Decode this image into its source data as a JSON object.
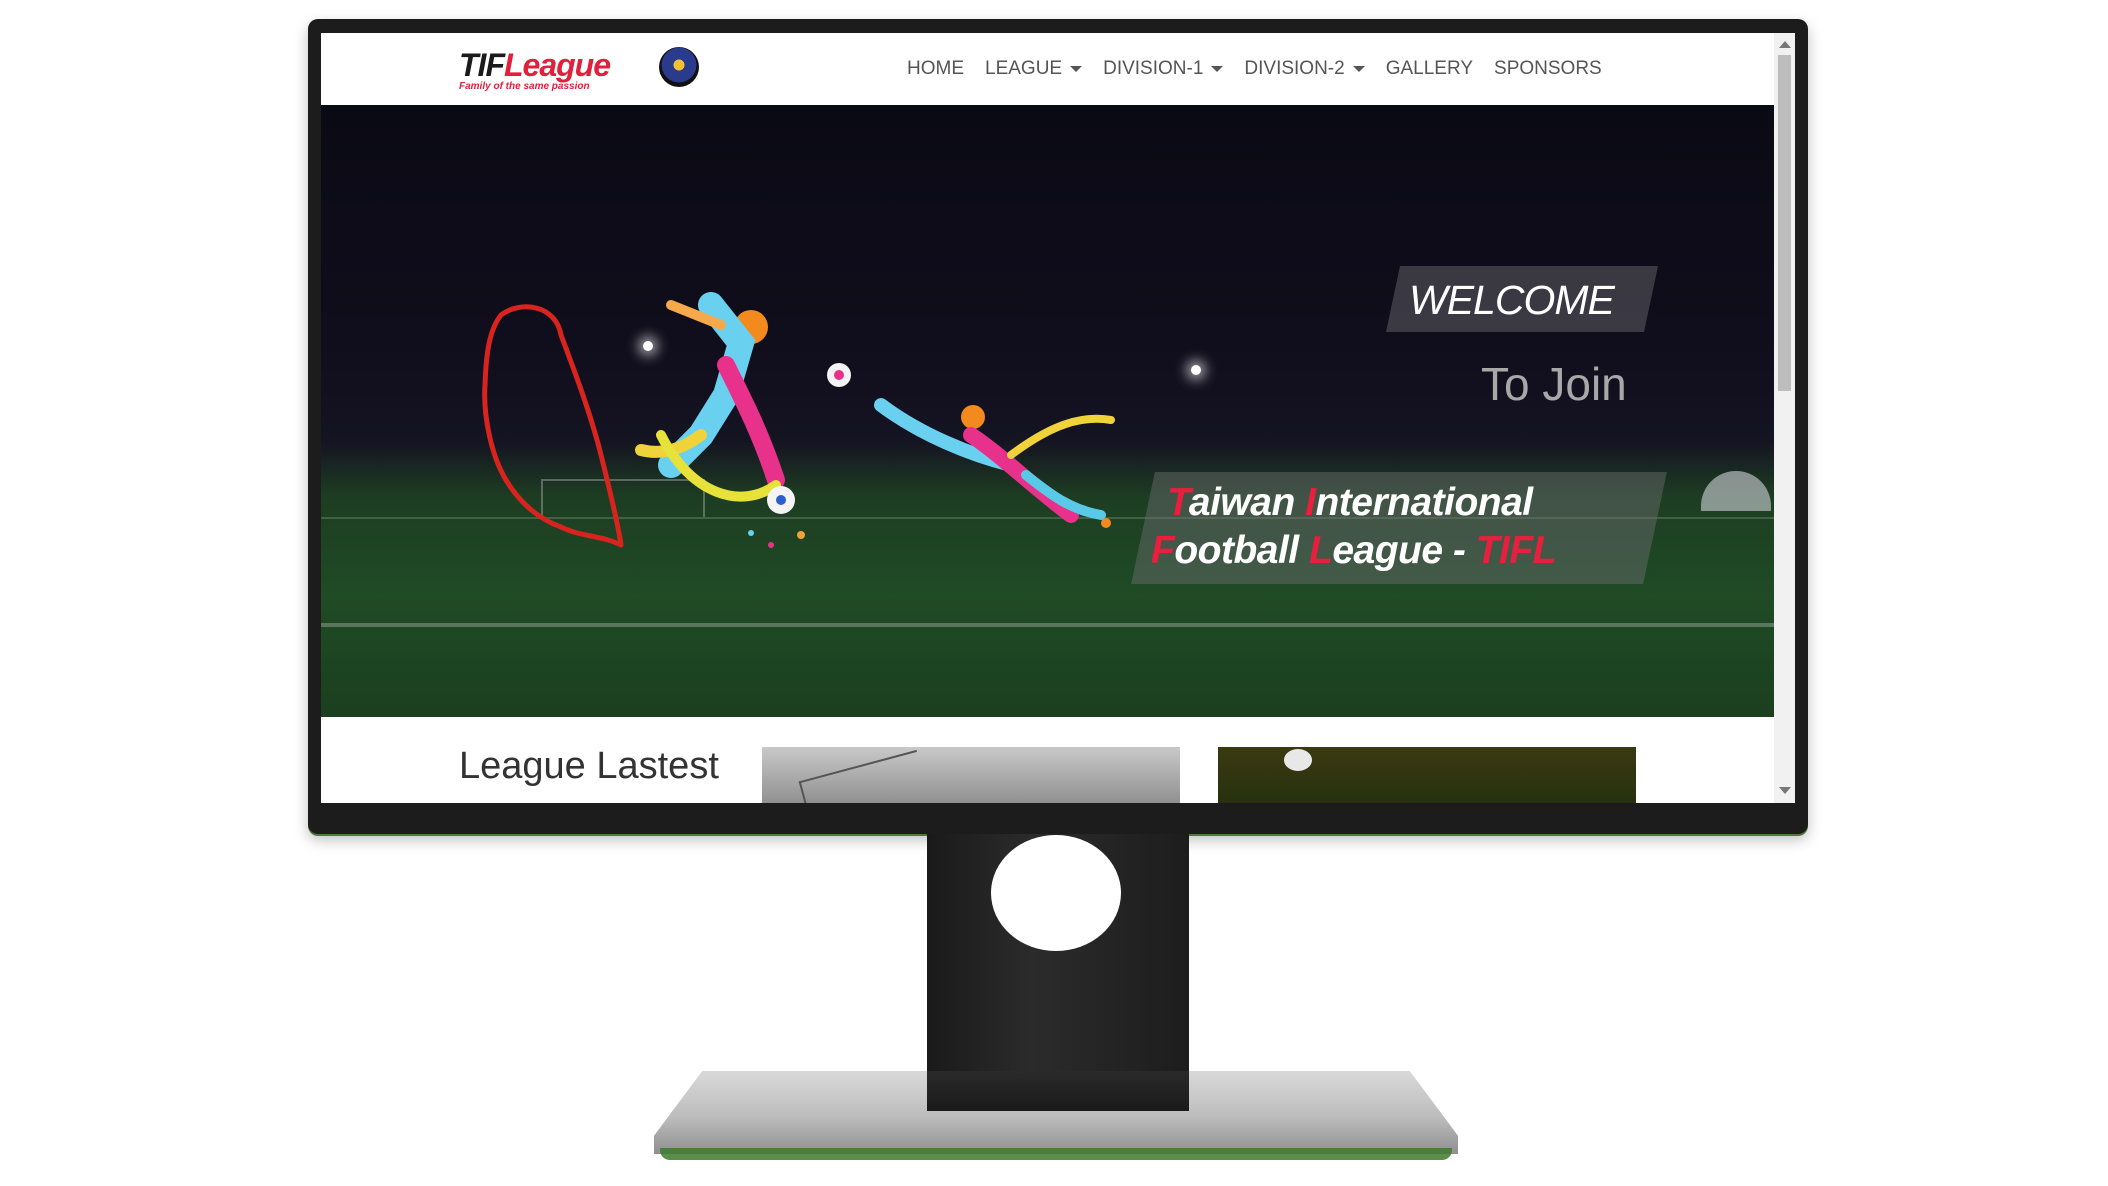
{
  "brand": {
    "logo_part1": "TIF",
    "logo_part2": "League",
    "tagline": "Family of the same passion"
  },
  "nav": {
    "items": [
      {
        "label": "HOME",
        "dropdown": false
      },
      {
        "label": "LEAGUE",
        "dropdown": true
      },
      {
        "label": "DIVISION-1",
        "dropdown": true
      },
      {
        "label": "DIVISION-2",
        "dropdown": true
      },
      {
        "label": "GALLERY",
        "dropdown": false
      },
      {
        "label": "SPONSORS",
        "dropdown": false
      }
    ]
  },
  "hero": {
    "welcome": "WELCOME",
    "to_join": "To Join",
    "line1": {
      "i1": "T",
      "w1": "aiwan ",
      "i2": "I",
      "w2": "nternational"
    },
    "line2": {
      "i1": "F",
      "w1": "ootball ",
      "i2": "L",
      "w2": "eague - ",
      "abbr": "TIFL"
    }
  },
  "section": {
    "title": "League Lastest"
  },
  "colors": {
    "accent": "#e8203e",
    "nav_text": "#555555",
    "bezel": "#1c1c1c"
  }
}
